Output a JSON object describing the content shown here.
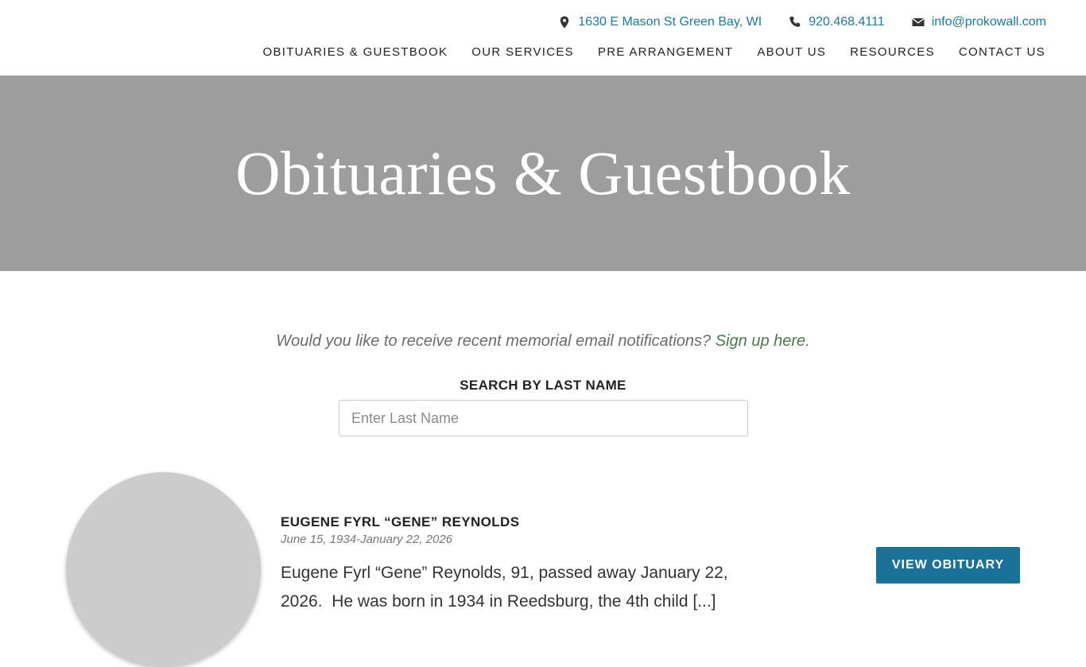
{
  "header": {
    "contact": {
      "address": "1630 E Mason St Green Bay, WI",
      "phone": "920.468.4111",
      "email": "info@prokowall.com"
    },
    "nav": [
      {
        "label": "OBITUARIES & GUESTBOOK"
      },
      {
        "label": "OUR SERVICES"
      },
      {
        "label": "PRE ARRANGEMENT"
      },
      {
        "label": "ABOUT US"
      },
      {
        "label": "RESOURCES"
      },
      {
        "label": "CONTACT US"
      }
    ]
  },
  "hero": {
    "title": "Obituaries & Guestbook"
  },
  "signup": {
    "text": "Would you like to receive recent memorial email notifications? ",
    "link": "Sign up here",
    "suffix": "."
  },
  "search": {
    "label": "SEARCH BY LAST NAME",
    "placeholder": "Enter Last Name",
    "value": ""
  },
  "obituaries": [
    {
      "name": "EUGENE FYRL “GENE” REYNOLDS",
      "dates": "June 15, 1934-January 22, 2026",
      "excerpt": "Eugene Fyrl “Gene” Reynolds, 91, passed away January 22, 2026.  He was born in 1934 in Reedsburg, the 4th child [...]",
      "button_label": "VIEW OBITUARY"
    }
  ],
  "colors": {
    "link": "#1a7aa0",
    "hero_bg": "#9d9d9d",
    "button_bg": "#1b7299",
    "signup_link": "#4a7a4f"
  },
  "icons": {
    "address": "map-pin-icon",
    "phone": "phone-icon",
    "email": "envelope-icon"
  }
}
